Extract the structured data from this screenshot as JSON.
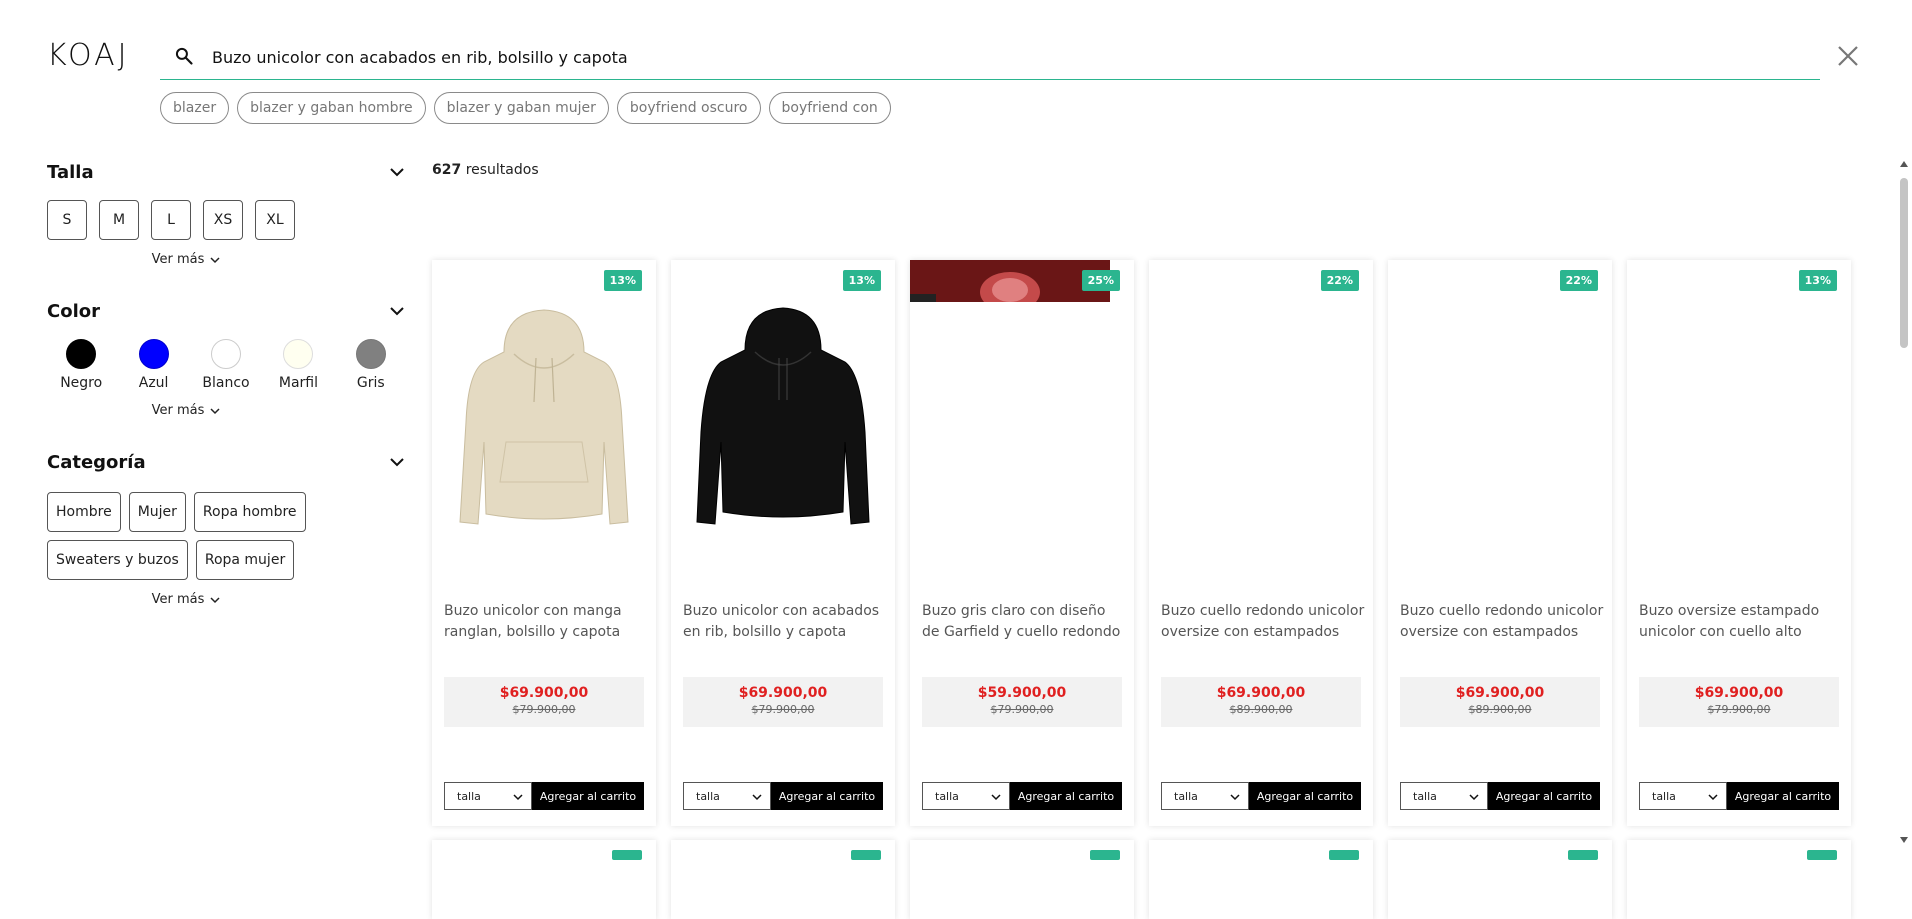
{
  "header": {
    "logo": "KOAJ",
    "search_value": "Buzo unicolor con acabados en rib, bolsillo y capota"
  },
  "suggestions": [
    "blazer",
    "blazer y gaban hombre",
    "blazer y gaban mujer",
    "boyfriend oscuro",
    "boyfriend con"
  ],
  "filters": {
    "talla": {
      "title": "Talla",
      "options": [
        "S",
        "M",
        "L",
        "XS",
        "XL"
      ],
      "ver_mas": "Ver más"
    },
    "color": {
      "title": "Color",
      "options": [
        {
          "label": "Negro",
          "hex": "#000000"
        },
        {
          "label": "Azul",
          "hex": "#0000ff"
        },
        {
          "label": "Blanco",
          "hex": "#ffffff"
        },
        {
          "label": "Marfil",
          "hex": "#fffff0"
        },
        {
          "label": "Gris",
          "hex": "#808080"
        }
      ],
      "ver_mas": "Ver más"
    },
    "categoria": {
      "title": "Categoría",
      "options": [
        "Hombre",
        "Mujer",
        "Ropa hombre",
        "Sweaters y buzos",
        "Ropa mujer"
      ],
      "ver_mas": "Ver más"
    }
  },
  "results": {
    "count": "627",
    "label": "resultados"
  },
  "products": [
    {
      "badge": "13%",
      "name": "Buzo unicolor con manga ranglan, bolsillo y capota",
      "price": "$69.900,00",
      "old_price": "$79.900,00",
      "image": "beige-hoodie"
    },
    {
      "badge": "13%",
      "name": "Buzo unicolor con acabados en rib, bolsillo y capota",
      "price": "$69.900,00",
      "old_price": "$79.900,00",
      "image": "black-hoodie"
    },
    {
      "badge": "25%",
      "name": "Buzo gris claro con diseño de Garfield y cuello redondo",
      "price": "$59.900,00",
      "old_price": "$79.900,00",
      "image": "garfield-photo-partial"
    },
    {
      "badge": "22%",
      "name": "Buzo cuello redondo unicolor oversize con estampados",
      "price": "$69.900,00",
      "old_price": "$89.900,00",
      "image": "none"
    },
    {
      "badge": "22%",
      "name": "Buzo cuello redondo unicolor oversize con estampados",
      "price": "$69.900,00",
      "old_price": "$89.900,00",
      "image": "none"
    },
    {
      "badge": "13%",
      "name": "Buzo oversize estampado unicolor con cuello alto",
      "price": "$69.900,00",
      "old_price": "$79.900,00",
      "image": "none"
    }
  ],
  "cart": {
    "talla_label": "talla",
    "add_label": "Agregar al carrito"
  },
  "colors": {
    "accent": "#2bb58f",
    "price_red": "#e02020"
  }
}
